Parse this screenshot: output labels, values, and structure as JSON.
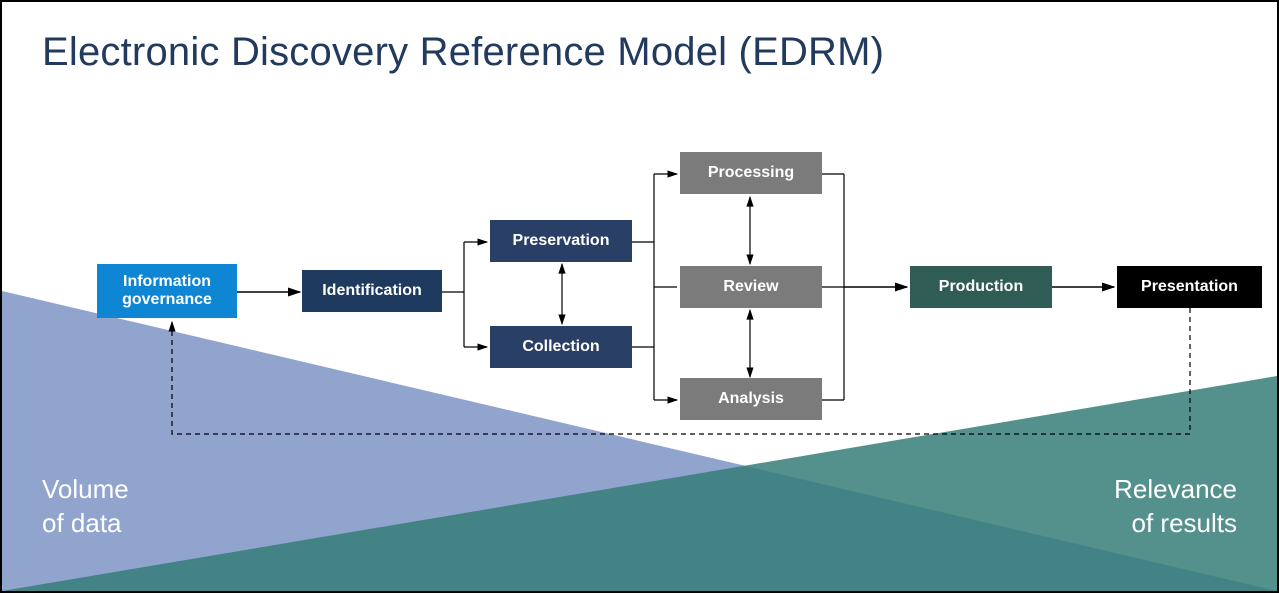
{
  "title": "Electronic Discovery Reference Model (EDRM)",
  "triangles": {
    "left_label_line1": "Volume",
    "left_label_line2": "of data",
    "right_label_line1": "Relevance",
    "right_label_line2": "of results"
  },
  "nodes": {
    "info_gov": "Information governance",
    "identification": "Identification",
    "preservation": "Preservation",
    "collection": "Collection",
    "processing": "Processing",
    "review": "Review",
    "analysis": "Analysis",
    "production": "Production",
    "presentation": "Presentation"
  },
  "colors": {
    "title": "#223a5e",
    "info_gov": "#0e86d4",
    "identification": "#1f3a5f",
    "preservation_collection": "#2a3f66",
    "processing_review_analysis": "#7b7b7b",
    "production": "#2f5d55",
    "presentation": "#000000",
    "volume_triangle": "#8ea3cd",
    "relevance_triangle": "#4a9b93"
  },
  "flow": [
    {
      "from": "info_gov",
      "to": "identification",
      "style": "arrow"
    },
    {
      "from": "identification",
      "to": "preservation",
      "style": "branch-arrow"
    },
    {
      "from": "identification",
      "to": "collection",
      "style": "branch-arrow"
    },
    {
      "between": [
        "preservation",
        "collection"
      ],
      "style": "double-arrow-vertical"
    },
    {
      "from": "preservation",
      "to": "processing",
      "style": "branch-arrow"
    },
    {
      "from": "preservation",
      "to": "review",
      "style": "branch-line"
    },
    {
      "from": "collection",
      "to": "review",
      "style": "branch-line"
    },
    {
      "from": "collection",
      "to": "analysis",
      "style": "branch-arrow"
    },
    {
      "between": [
        "processing",
        "review"
      ],
      "style": "double-arrow-vertical"
    },
    {
      "between": [
        "review",
        "analysis"
      ],
      "style": "double-arrow-vertical"
    },
    {
      "from": "processing",
      "to": "production",
      "style": "merge-arrow"
    },
    {
      "from": "review",
      "to": "production",
      "style": "merge-line"
    },
    {
      "from": "analysis",
      "to": "production",
      "style": "merge-line"
    },
    {
      "from": "production",
      "to": "presentation",
      "style": "arrow"
    },
    {
      "from": "presentation",
      "to": "info_gov",
      "style": "dashed-feedback"
    }
  ]
}
